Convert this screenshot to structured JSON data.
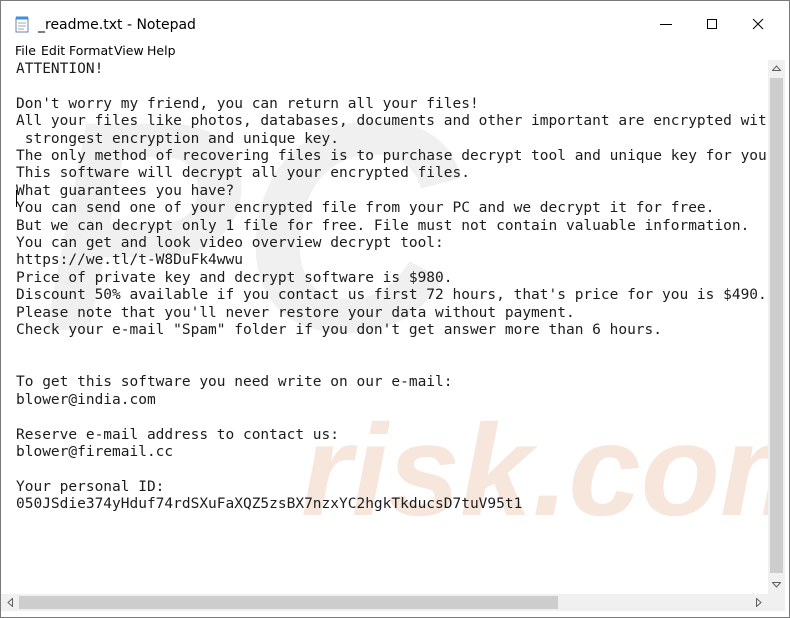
{
  "window": {
    "title": "_readme.txt - Notepad"
  },
  "menu": {
    "file": "File",
    "edit": "Edit",
    "format": "Format",
    "view": "View",
    "help": "Help"
  },
  "document": {
    "lines": [
      "ATTENTION!",
      "",
      "Don't worry my friend, you can return all your files!",
      "All your files like photos, databases, documents and other important are encrypted with",
      " strongest encryption and unique key.",
      "The only method of recovering files is to purchase decrypt tool and unique key for you.",
      "This software will decrypt all your encrypted files.",
      "What guarantees you have?",
      "You can send one of your encrypted file from your PC and we decrypt it for free.",
      "But we can decrypt only 1 file for free. File must not contain valuable information.",
      "You can get and look video overview decrypt tool:",
      "https://we.tl/t-W8DuFk4wwu",
      "Price of private key and decrypt software is $980.",
      "Discount 50% available if you contact us first 72 hours, that's price for you is $490.",
      "Please note that you'll never restore your data without payment.",
      "Check your e-mail \"Spam\" folder if you don't get answer more than 6 hours.",
      "",
      "",
      "To get this software you need write on our e-mail:",
      "blower@india.com",
      "",
      "Reserve e-mail address to contact us:",
      "blower@firemail.cc",
      "",
      "Your personal ID:",
      "050JSdie374yHduf74rdSXuFaXQZ5zsBX7nzxYC2hgkTkducsD7tuV95t1"
    ]
  },
  "watermark": {
    "brand": "PC",
    "domain": "risk.com"
  },
  "icons": {
    "app": "notepad-icon",
    "minimize": "minimize-icon",
    "maximize": "maximize-icon",
    "close": "close-icon"
  },
  "colors": {
    "text": "#1c1c1c",
    "scrollbar_track": "#f0f0f0",
    "scrollbar_thumb": "#cdcdcd",
    "watermark": "#c8c8c8"
  }
}
